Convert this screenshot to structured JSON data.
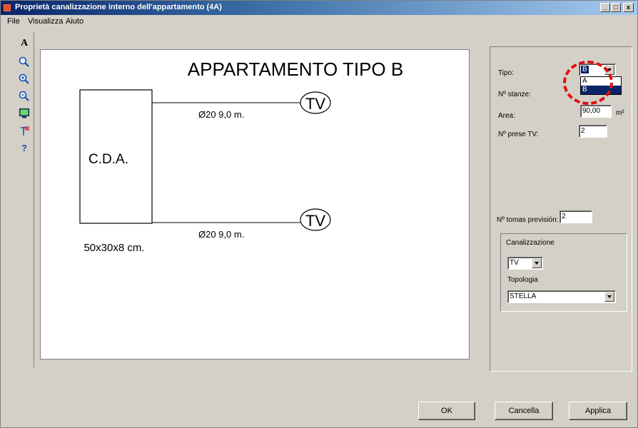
{
  "window": {
    "title": "Proprietà canalizzazione interno dell'appartamento  (4A)",
    "controls": {
      "minimize": "_",
      "maximize": "□",
      "close": "x"
    }
  },
  "menu": {
    "file": "File",
    "view": "Visualizza",
    "help": "Aiuto"
  },
  "toolbar": {
    "items": [
      {
        "name": "text-tool",
        "icon": "text-icon",
        "glyph": "A"
      },
      {
        "name": "zoom",
        "icon": "magnifier-icon"
      },
      {
        "name": "zoom-in",
        "icon": "zoom-in-icon"
      },
      {
        "name": "zoom-out",
        "icon": "zoom-out-icon"
      },
      {
        "name": "print-preview",
        "icon": "monitor-icon"
      },
      {
        "name": "symbols",
        "icon": "antenna-icon"
      },
      {
        "name": "help",
        "icon": "question-icon",
        "glyph": "?"
      }
    ]
  },
  "diagram": {
    "title": "APPARTAMENTO TIPO B",
    "box_label": "C.D.A.",
    "box_size": "50x30x8 cm.",
    "outlet_1": "TV",
    "cable_1": "Ø20 9,0 m.",
    "outlet_2": "TV",
    "cable_2": "Ø20 9,0 m."
  },
  "panel": {
    "tipo_label": "Tipo:",
    "tipo_value": "B",
    "tipo_options": [
      "A",
      "B"
    ],
    "stanze_label": "Nº stanze:",
    "area_label": "Area:",
    "area_value": "90,00",
    "area_unit": "m²",
    "prese_label": "Nº prese TV:",
    "prese_value": "2",
    "tomas_label": "Nº tomas previsión:",
    "tomas_value": "2",
    "canal_label": "Canalizzazione",
    "canal_value": "TV",
    "topo_label": "Topologia",
    "topo_value": "STELLA"
  },
  "buttons": {
    "ok": "OK",
    "cancel": "Cancella",
    "apply": "Applica"
  },
  "colors": {
    "titlebar": "#0a246a",
    "face": "#d4d0c8",
    "highlight": "#e01010"
  }
}
